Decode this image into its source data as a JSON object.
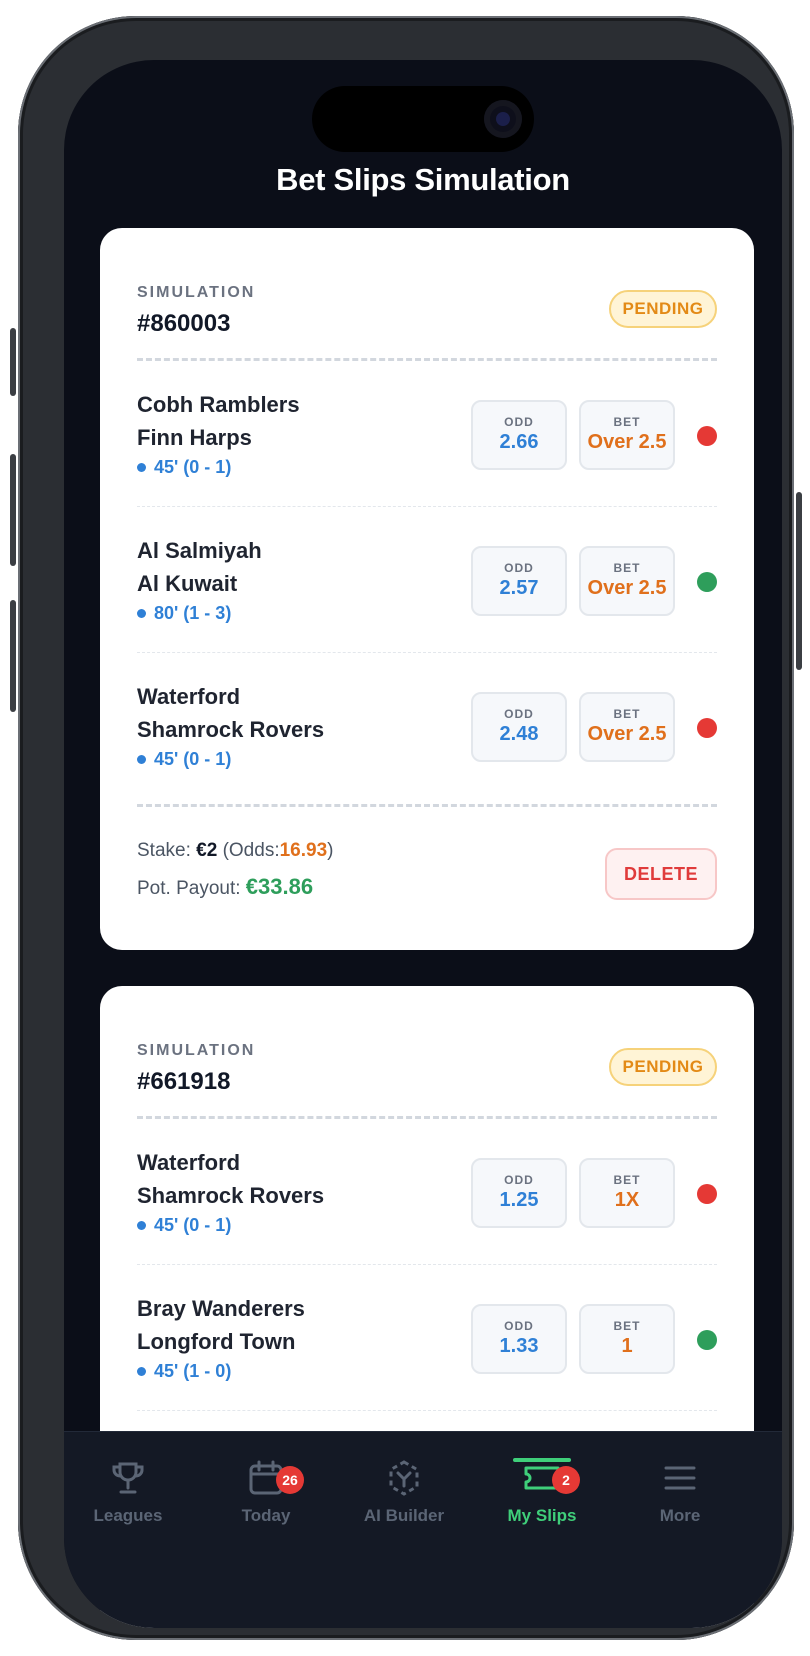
{
  "header": {
    "title": "Bet Slips Simulation"
  },
  "colors": {
    "pending": "#e38a16",
    "odd": "#2f80d6",
    "bet": "#e0701c",
    "lost": "#e53935",
    "won": "#2e9e5b",
    "payout": "#2e9e5b",
    "odds_total": "#e0701c",
    "active_tab": "#3fcf7a"
  },
  "slips": [
    {
      "label": "SIMULATION",
      "id": "#860003",
      "status": "PENDING",
      "matches": [
        {
          "home": "Cobh Ramblers",
          "away": "Finn Harps",
          "minute_score": "45' (0 - 1)",
          "odd_label": "ODD",
          "odd": "2.66",
          "bet_label": "BET",
          "bet": "Over 2.5",
          "result": "lost"
        },
        {
          "home": "Al Salmiyah",
          "away": "Al Kuwait",
          "minute_score": "80' (1 - 3)",
          "odd_label": "ODD",
          "odd": "2.57",
          "bet_label": "BET",
          "bet": "Over 2.5",
          "result": "won"
        },
        {
          "home": "Waterford",
          "away": "Shamrock Rovers",
          "minute_score": "45' (0 - 1)",
          "odd_label": "ODD",
          "odd": "2.48",
          "bet_label": "BET",
          "bet": "Over 2.5",
          "result": "lost"
        }
      ],
      "stake_label": "Stake:",
      "stake": "€2",
      "odds_label": "(Odds:",
      "odds": "16.93",
      "odds_close": ")",
      "payout_label": "Pot. Payout:",
      "payout": "€33.86",
      "delete_label": "DELETE"
    },
    {
      "label": "SIMULATION",
      "id": "#661918",
      "status": "PENDING",
      "matches": [
        {
          "home": "Waterford",
          "away": "Shamrock Rovers",
          "minute_score": "45' (0 - 1)",
          "odd_label": "ODD",
          "odd": "1.25",
          "bet_label": "BET",
          "bet": "1X",
          "result": "lost"
        },
        {
          "home": "Bray Wanderers",
          "away": "Longford Town",
          "minute_score": "45' (1 - 0)",
          "odd_label": "ODD",
          "odd": "1.33",
          "bet_label": "BET",
          "bet": "1",
          "result": "won"
        }
      ]
    }
  ],
  "tabs": [
    {
      "label": "Leagues",
      "icon": "trophy-icon"
    },
    {
      "label": "Today",
      "icon": "calendar-icon",
      "badge": "26"
    },
    {
      "label": "AI Builder",
      "icon": "ai-builder-icon"
    },
    {
      "label": "My Slips",
      "icon": "ticket-icon",
      "badge": "2",
      "active": true
    },
    {
      "label": "More",
      "icon": "menu-icon"
    }
  ]
}
